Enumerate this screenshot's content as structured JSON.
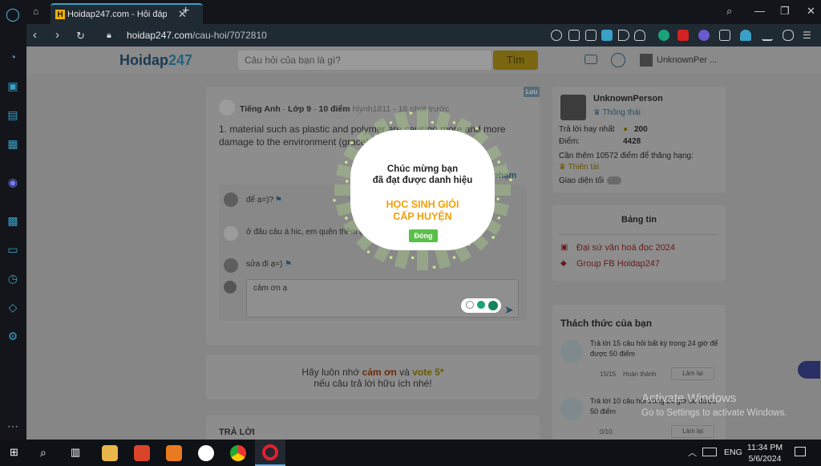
{
  "browser": {
    "tab_title": "Hoidap247.com - Hỏi đáp",
    "tab_favicon": "H",
    "url_host": "hoidap247.com",
    "url_path": "/cau-hoi/7072810"
  },
  "site": {
    "logo_main": "Hoidap",
    "logo_num": "247",
    "search_placeholder": "Câu hỏi của bạn là gì?",
    "search_button": "Tìm",
    "username_short": "UnknownPer ..."
  },
  "question": {
    "save_badge": "Lưu",
    "subject": "Tiếng Anh",
    "grade": "Lớp 9",
    "points": "10 điểm",
    "author": "hlynh1811",
    "time": "18 phút trước",
    "body": "1. material such as plastic and polymer are causing more and more damage to the environment (grace)",
    "report_link": "phạm"
  },
  "comments": [
    {
      "text": "để ạ=)?"
    },
    {
      "text": "ở đâu câu á hic, em quên thêm ạ"
    },
    {
      "text": "sửa đi ạ=)"
    }
  ],
  "comment_input": {
    "value": "cảm ơn ạ"
  },
  "thanks_box": {
    "line1_a": "Hãy luôn nhớ ",
    "line1_b": "cảm ơn",
    "line1_c": " và ",
    "line1_d": "vote 5*",
    "line2": "nếu câu trả lời hữu ích nhé!"
  },
  "answers_heading": "TRẢ LỜI",
  "profile": {
    "name": "UnknownPerson",
    "status": "Thông thái",
    "best_answers_label": "Trả lời hay nhất",
    "best_answers_value": "200",
    "points_label": "Điểm:",
    "points_value": "4428",
    "rank_text": "Cần thêm 10572 điểm để thăng hạng:",
    "rank_name": "Thiên tài",
    "theme_label": "Giao diện tối"
  },
  "news": {
    "title": "Bảng tin",
    "items": [
      "Đại sứ văn hoá đọc 2024",
      "Group FB Hoidap247"
    ]
  },
  "challenges": {
    "title": "Thách thức của bạn",
    "items": [
      {
        "text": "Trả lời 15 câu hỏi  bất kỳ  trong 24 giờ để được 50 điểm",
        "progress": "15/15",
        "status": "Hoàn thành",
        "button": "Làm lại"
      },
      {
        "text": "Trả lời 10 câu hỏi  trong 24 giờ để được 50 điểm",
        "progress": "0/10",
        "status": "",
        "button": "Làm lại"
      }
    ]
  },
  "popup": {
    "line1": "Chúc mừng bạn",
    "line2": "đã đạt được danh hiệu",
    "title1": "HỌC SINH GIỎI",
    "title2": "CẤP HUYỆN",
    "close": "Đóng"
  },
  "watermark": {
    "line1": "Activate Windows",
    "line2": "Go to Settings to activate Windows."
  },
  "taskbar": {
    "lang": "ENG",
    "time": "11:34 PM",
    "date": "5/6/2024"
  },
  "colors": {
    "accent": "#3aa0c8",
    "gold": "#f2a10a",
    "close_green": "#5bbf4a"
  }
}
